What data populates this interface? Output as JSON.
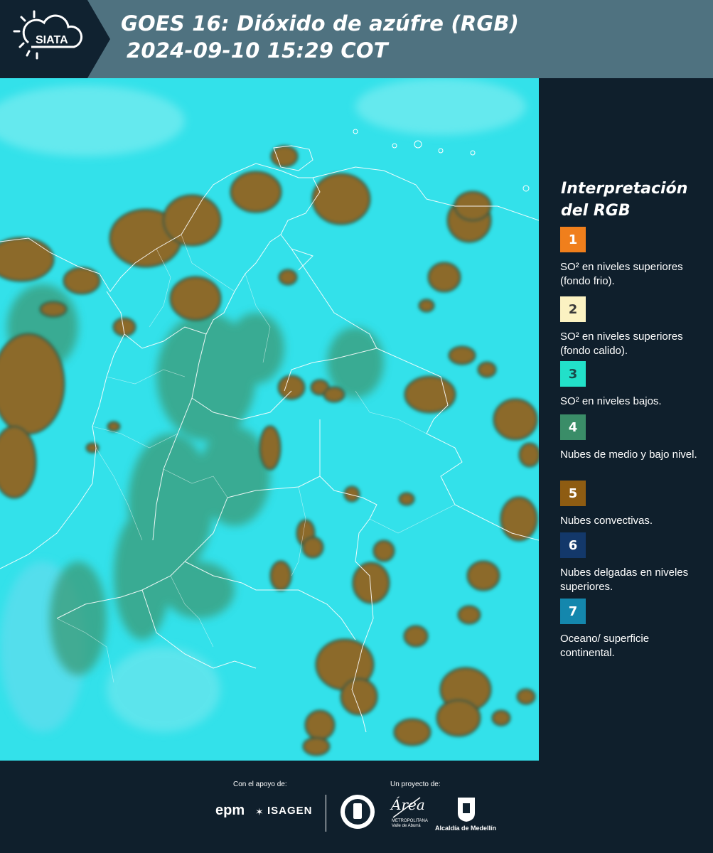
{
  "header": {
    "logo_text": "SIATA",
    "title_line1": "GOES 16: Dióxido de azúfre (RGB)",
    "title_line2": "2024-09-10 15:29 COT"
  },
  "legend": {
    "title_line1": "Interpretación",
    "title_line2": "del RGB",
    "items": [
      {
        "number": "1",
        "label": "SO² en niveles superiores (fondo frio).",
        "color": "#f07f1c",
        "text_color": "#ffffff"
      },
      {
        "number": "2",
        "label": "SO² en niveles superiores (fondo calido).",
        "color": "#fbf2c2",
        "text_color": "#3a3a3a"
      },
      {
        "number": "3",
        "label": "SO² en niveles bajos.",
        "color": "#22e0c9",
        "text_color": "#1a4a4a"
      },
      {
        "number": "4",
        "label": "Nubes de medio y bajo nivel.",
        "color": "#3a8d68",
        "text_color": "#ffffff"
      },
      {
        "number": "5",
        "label": "Nubes convectivas.",
        "color": "#8e5c12",
        "text_color": "#ffffff"
      },
      {
        "number": "6",
        "label": "Nubes delgadas en niveles superiores.",
        "color": "#13386a",
        "text_color": "#ffffff"
      },
      {
        "number": "7",
        "label": "Oceano/ superficie continental.",
        "color": "#1487ad",
        "text_color": "#ffffff"
      }
    ]
  },
  "footer": {
    "support_label": "Con el apoyo de:",
    "project_label": "Un proyecto de:",
    "sponsor_epm": "epm",
    "sponsor_isagen": "ISAGEN",
    "area_name": "Área",
    "area_sub1": "METROPOLITANA",
    "area_sub2": "Valle de Aburrá",
    "alcaldia": "Alcaldía de Medellín"
  },
  "map": {
    "background_color": "#33e1ea",
    "convective_color": "#8c6a2c",
    "lowcloud_color": "#3a9a76",
    "border_color": "#ffffff"
  }
}
